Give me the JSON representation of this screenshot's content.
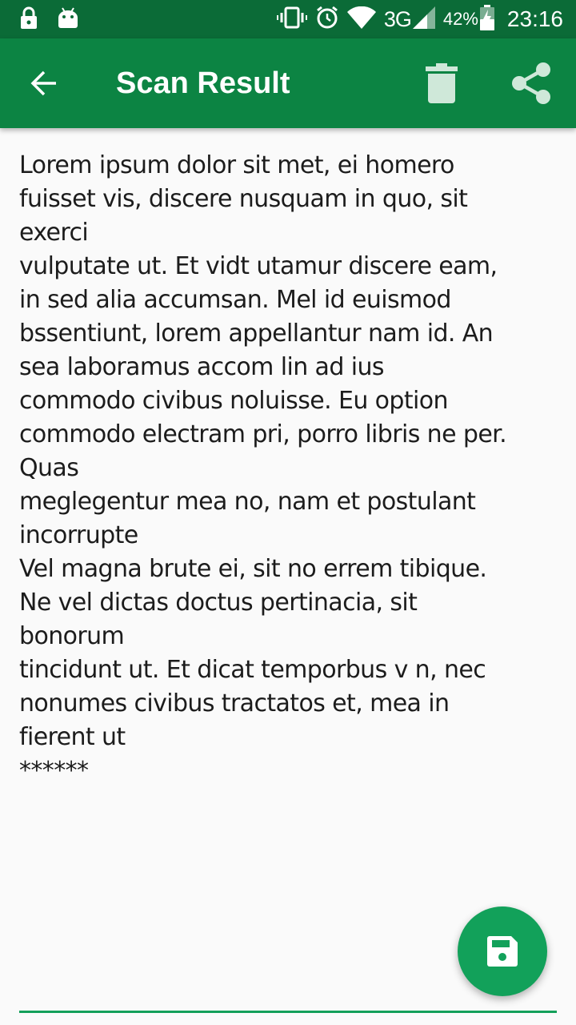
{
  "status_bar": {
    "left_icons": [
      "lock-icon",
      "android-icon"
    ],
    "right_icons": [
      "vibrate-icon",
      "alarm-icon",
      "wifi-icon",
      "signal-icon",
      "battery-charging-icon"
    ],
    "network": "3G",
    "battery": "42%",
    "time": "23:16"
  },
  "app_bar": {
    "title": "Scan Result",
    "back_icon": "arrow-back-icon",
    "actions": [
      {
        "icon": "delete-icon"
      },
      {
        "icon": "share-icon"
      }
    ]
  },
  "scan_result": {
    "lines": [
      "Lorem ipsum dolor sit met, ei homero",
      "fuisset vis, discere nusquam in quo, sit",
      "exerci",
      "vulputate ut. Et vidt utamur discere eam,",
      "in sed alia accumsan. Mel id euismod",
      "bssentiunt, lorem appellantur nam id. An",
      "sea laboramus accom lin ad ius",
      "commodo civibus noluisse. Eu option",
      "commodo electram pri, porro libris ne per.",
      "Quas",
      "meglegentur mea no, nam et postulant",
      "incorrupte",
      "Vel magna brute ei, sit no errem tibique.",
      "Ne vel dictas doctus pertinacia, sit",
      "bonorum",
      "tincidunt ut. Et dicat temporbus v n, nec",
      "nonumes civibus tractatos et, mea in",
      "fierent ut",
      " ******"
    ]
  },
  "fab": {
    "icon": "save-icon"
  },
  "colors": {
    "status_bar": "#0b6b37",
    "app_bar": "#0c8443",
    "accent": "#12a15a",
    "icon_muted": "#cfe8d9",
    "background": "#fafafa",
    "text": "#1c1c1c"
  }
}
